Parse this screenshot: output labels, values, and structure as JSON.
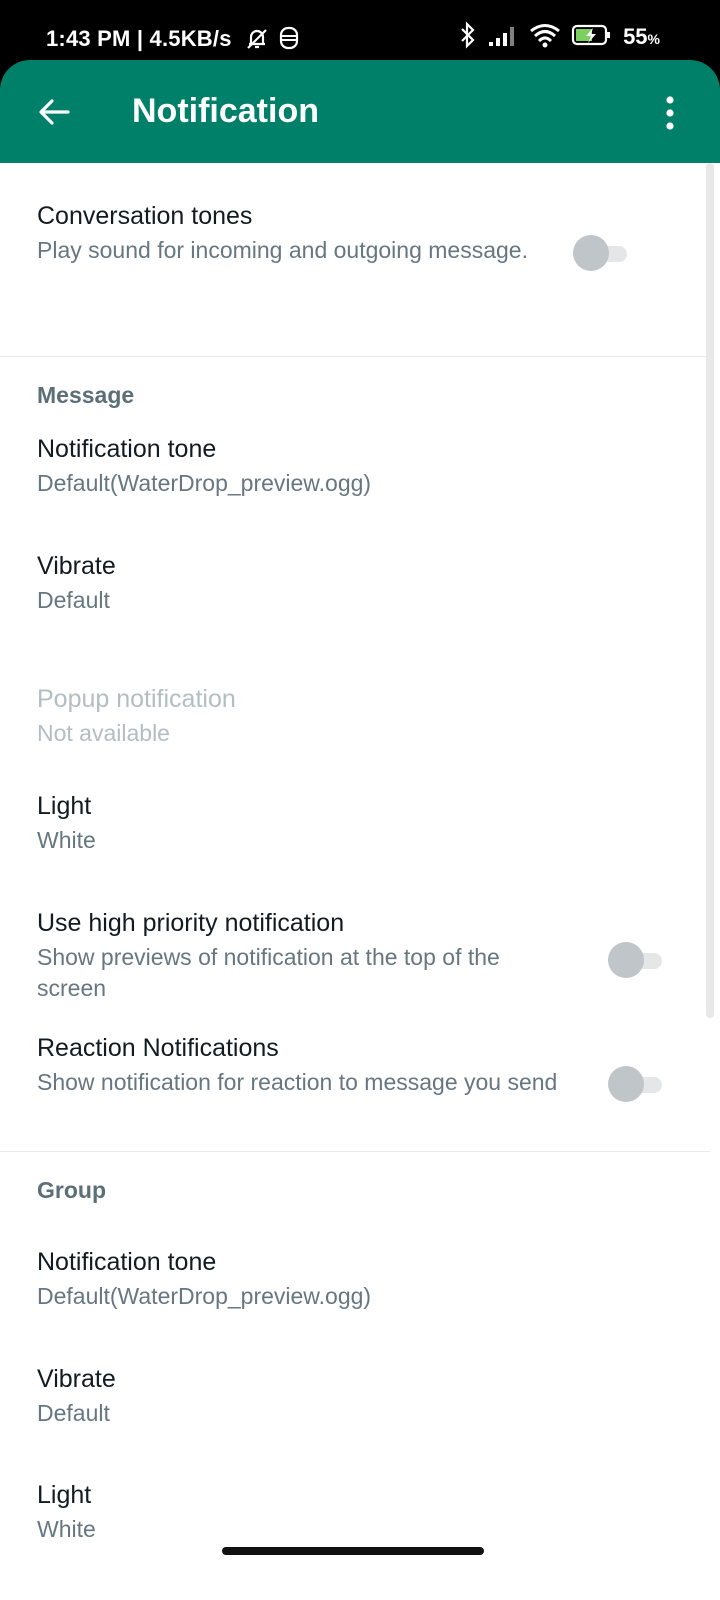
{
  "status_bar": {
    "time_speed": "1:43 PM | 4.5KB/s",
    "battery_percent": "55",
    "battery_unit": "%"
  },
  "header": {
    "title": "Notification"
  },
  "conversation_tones": {
    "title": "Conversation tones",
    "subtitle": "Play sound for incoming and outgoing message.",
    "enabled": false
  },
  "message_section": {
    "header": "Message",
    "notification_tone": {
      "title": "Notification tone",
      "value": "Default(WaterDrop_preview.ogg)"
    },
    "vibrate": {
      "title": "Vibrate",
      "value": "Default"
    },
    "popup": {
      "title": "Popup notification",
      "value": "Not available"
    },
    "light": {
      "title": "Light",
      "value": "White"
    },
    "high_priority": {
      "title": "Use high priority notification",
      "subtitle": "Show previews of notification at the top of the screen",
      "enabled": false
    },
    "reaction": {
      "title": "Reaction Notifications",
      "subtitle": "Show notification for reaction to message you send",
      "enabled": false
    }
  },
  "group_section": {
    "header": "Group",
    "notification_tone": {
      "title": "Notification tone",
      "value": "Default(WaterDrop_preview.ogg)"
    },
    "vibrate": {
      "title": "Vibrate",
      "value": "Default"
    },
    "light": {
      "title": "Light",
      "value": "White"
    }
  },
  "colors": {
    "appbar": "#008069",
    "toggle_off_knob": "#bfc5c8",
    "toggle_off_track": "#e4e6e7"
  }
}
